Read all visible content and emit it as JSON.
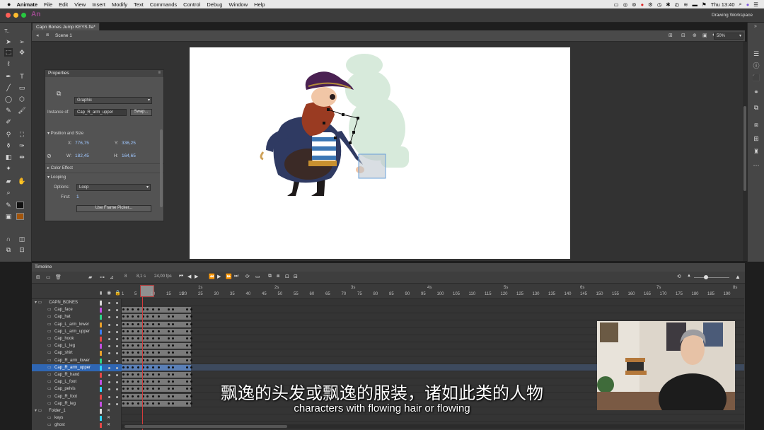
{
  "menubar": {
    "apple": "",
    "app_name": "Animate",
    "items": [
      "File",
      "Edit",
      "View",
      "Insert",
      "Modify",
      "Text",
      "Commands",
      "Control",
      "Debug",
      "Window",
      "Help"
    ],
    "clock": "Thu 13:40"
  },
  "appbar": {
    "logo": "An",
    "workspace": "Drawing Workspace"
  },
  "document": {
    "tab": "Capn Bones Jump KEYS.fla*",
    "scene": "Scene 1",
    "zoom": "50%"
  },
  "properties": {
    "title": "Properties",
    "type": "Graphic",
    "instance_label": "Instance of:",
    "instance_name": "Cap_R_arm_upper",
    "swap_label": "Swap...",
    "position_section": "Position and Size",
    "x_label": "X:",
    "x_value": "776,75",
    "y_label": "Y:",
    "y_value": "336,25",
    "w_label": "W:",
    "w_value": "182,45",
    "h_label": "H:",
    "h_value": "164,65",
    "color_effect": "Color Effect",
    "looping": "Looping",
    "options_label": "Options:",
    "options_value": "Loop",
    "first_label": "First:",
    "first_value": "1",
    "frame_picker": "Use Frame Picker..."
  },
  "timeline": {
    "title": "Timeline",
    "current_frame": "8",
    "frame_display": "8,1 s",
    "fps": "24,00 fps",
    "ruler_frames": [
      "1",
      "5",
      "10",
      "15",
      "20",
      "25",
      "30",
      "35",
      "40",
      "45",
      "50",
      "55",
      "60",
      "65",
      "70",
      "75",
      "80",
      "85",
      "90",
      "95",
      "100",
      "105",
      "110",
      "115",
      "120",
      "125",
      "130",
      "135",
      "140",
      "145",
      "150",
      "155",
      "160",
      "165",
      "170",
      "175",
      "180",
      "185",
      "190",
      "19"
    ],
    "ruler_seconds": [
      "1s",
      "2s",
      "3s",
      "4s",
      "5s",
      "6s",
      "7s",
      "8s"
    ],
    "layers": [
      {
        "name": "CAPN_BONES",
        "folder": true,
        "color": "#d9d9d9"
      },
      {
        "name": "Cap_face",
        "color": "#c24ee0"
      },
      {
        "name": "Cap_hat",
        "color": "#2ed38a"
      },
      {
        "name": "Cap_L_arm_lower",
        "color": "#e8a02a"
      },
      {
        "name": "Cap_L_arm_upper",
        "color": "#3a7cf0"
      },
      {
        "name": "Cap_hook",
        "color": "#e34747"
      },
      {
        "name": "Cap_L_leg",
        "color": "#c24ee0"
      },
      {
        "name": "Cap_shirt",
        "color": "#e8a02a"
      },
      {
        "name": "Cap_R_arm_lower",
        "color": "#2ed38a"
      },
      {
        "name": "Cap_R_arm_upper",
        "color": "#2fd6ff",
        "selected": true
      },
      {
        "name": "Cap_R_hand",
        "color": "#e34747"
      },
      {
        "name": "Cap_L_foot",
        "color": "#c24ee0"
      },
      {
        "name": "Cap_pelvis",
        "color": "#2fd6ff"
      },
      {
        "name": "Cap_R_foot",
        "color": "#e34747"
      },
      {
        "name": "Cap_R_leg",
        "color": "#c24ee0"
      },
      {
        "name": "Folder_1",
        "folder": true,
        "color": "#d9d9d9"
      },
      {
        "name": "keys",
        "color": "#2fd6ff"
      },
      {
        "name": "ghost",
        "color": "#e34747"
      }
    ]
  },
  "subtitles": {
    "zh": "飘逸的头发或飘逸的服装，诸如此类的人物",
    "en": "characters with flowing hair or flowing"
  }
}
